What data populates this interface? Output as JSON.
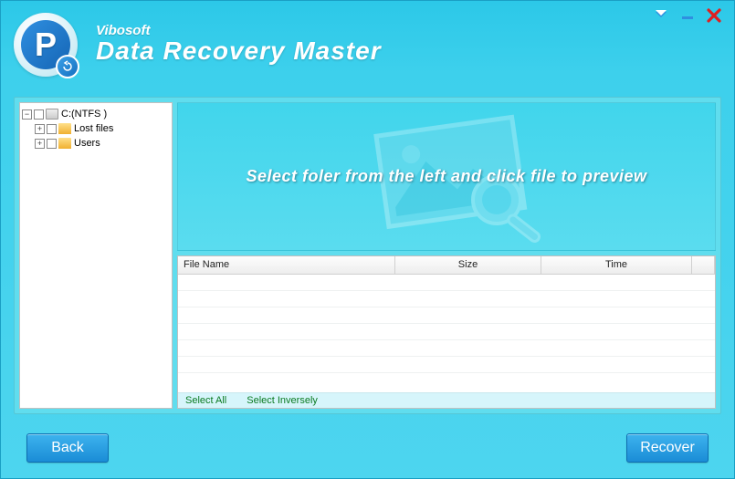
{
  "header": {
    "brand": "Vibosoft",
    "title": "Data Recovery Master",
    "logo_letter": "P"
  },
  "tree": {
    "root": {
      "label": "C:(NTFS )",
      "expanded": true
    },
    "children": [
      {
        "label": "Lost files"
      },
      {
        "label": "Users"
      }
    ]
  },
  "banner": {
    "message": "Select  foler from the left and click file to preview"
  },
  "table": {
    "headers": {
      "name": "File Name",
      "size": "Size",
      "time": "Time"
    },
    "rows": []
  },
  "select_bar": {
    "select_all": "Select All",
    "select_inversely": "Select Inversely"
  },
  "footer": {
    "back_label": "Back",
    "recover_label": "Recover"
  }
}
